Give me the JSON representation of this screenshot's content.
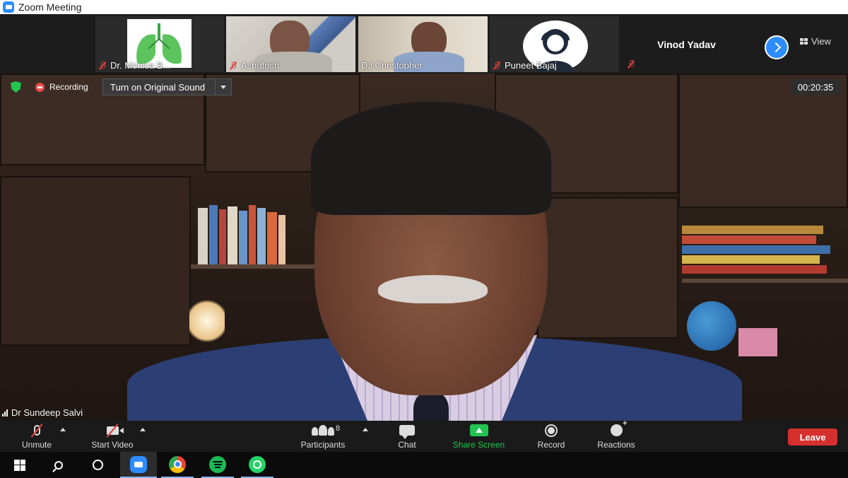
{
  "window": {
    "title": "Zoom Meeting"
  },
  "gallery": {
    "tiles": [
      {
        "name": "Dr. Monica B...",
        "muted": true
      },
      {
        "name": "Ashutosh",
        "muted": true
      },
      {
        "name": "DJ Christopher",
        "muted": false
      },
      {
        "name": "Puneet Bajaj",
        "muted": true
      },
      {
        "name": "Vinod Yadav",
        "muted": true
      }
    ],
    "view_label": "View"
  },
  "meeting": {
    "recording_label": "Recording",
    "sound_button_label": "Turn on Original Sound",
    "timer": "00:20:35",
    "active_speaker": "Dr Sundeep Salvi"
  },
  "toolbar": {
    "unmute_label": "Unmute",
    "start_video_label": "Start Video",
    "participants_label": "Participants",
    "participant_count": "8",
    "chat_label": "Chat",
    "share_screen_label": "Share Screen",
    "record_label": "Record",
    "reactions_label": "Reactions",
    "leave_label": "Leave"
  },
  "colors": {
    "zoom_blue": "#2D8CFF",
    "share_green": "#23C552",
    "leave_red": "#D6302E",
    "mute_red": "#E03E3E"
  },
  "taskbar": {
    "apps": [
      "windows-start-icon",
      "search-icon",
      "cortana-icon",
      "zoom-app-icon",
      "chrome-icon",
      "spotify-icon",
      "whatsapp-icon"
    ]
  }
}
